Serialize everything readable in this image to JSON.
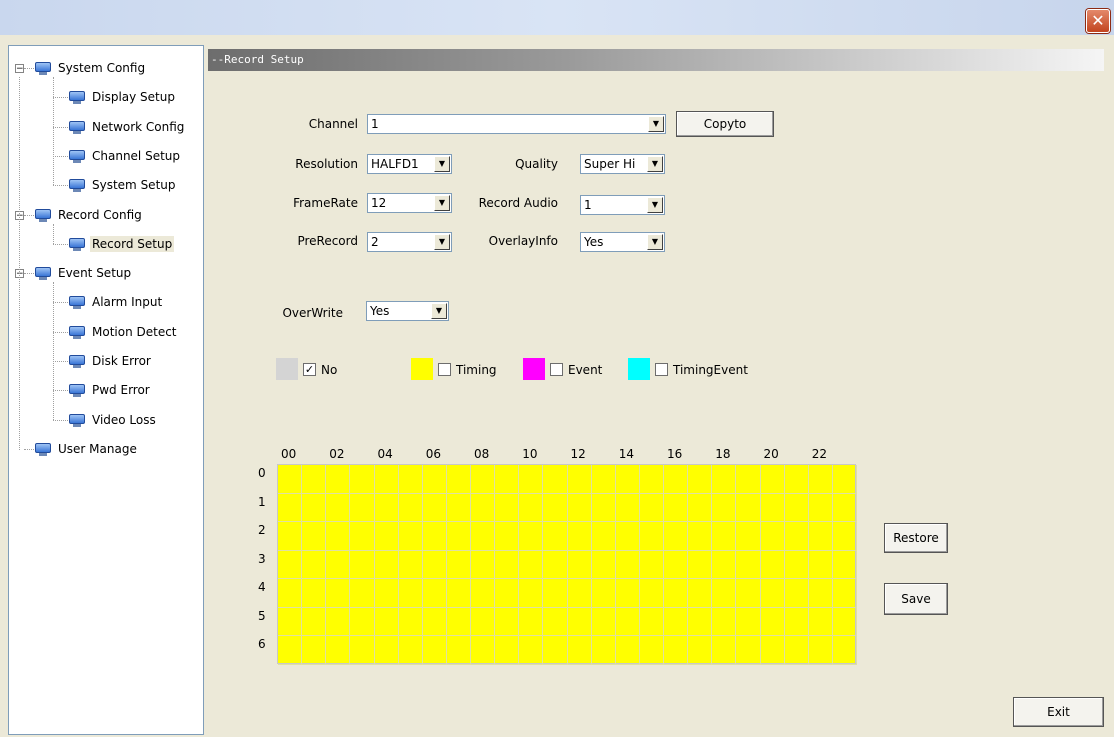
{
  "window": {
    "close_glyph": "✕"
  },
  "tree": {
    "nodes": [
      {
        "label": "System Config",
        "level": 0,
        "expander": "−"
      },
      {
        "label": "Display Setup",
        "level": 1
      },
      {
        "label": "Network Config",
        "level": 1
      },
      {
        "label": "Channel Setup",
        "level": 1
      },
      {
        "label": "System Setup",
        "level": 1
      },
      {
        "label": "Record Config",
        "level": 0,
        "expander": "−"
      },
      {
        "label": "Record Setup",
        "level": 1,
        "selected": true
      },
      {
        "label": "Event Setup",
        "level": 0,
        "expander": "−"
      },
      {
        "label": "Alarm Input",
        "level": 1
      },
      {
        "label": "Motion Detect",
        "level": 1
      },
      {
        "label": "Disk Error",
        "level": 1
      },
      {
        "label": "Pwd Error",
        "level": 1
      },
      {
        "label": "Video Loss",
        "level": 1
      },
      {
        "label": "User Manage",
        "level": 0
      }
    ]
  },
  "panel": {
    "title": "--Record Setup",
    "channel": {
      "label": "Channel",
      "value": "1"
    },
    "copyto_label": "Copyto",
    "resolution": {
      "label": "Resolution",
      "value": "HALFD1"
    },
    "quality": {
      "label": "Quality",
      "value": "Super Hi"
    },
    "framerate": {
      "label": "FrameRate",
      "value": "12"
    },
    "record_audio": {
      "label": "Record Audio",
      "value": "1"
    },
    "prerecord": {
      "label": "PreRecord",
      "value": "2"
    },
    "overlayinfo": {
      "label": "OverlayInfo",
      "value": "Yes"
    },
    "overwrite": {
      "label": "OverWrite",
      "value": "Yes"
    },
    "legend": [
      {
        "name": "No",
        "color": "#d4d4d4",
        "checked": true
      },
      {
        "name": "Timing",
        "color": "#ffff00",
        "checked": false
      },
      {
        "name": "Event",
        "color": "#ff00ff",
        "checked": false
      },
      {
        "name": "TimingEvent",
        "color": "#00ffff",
        "checked": false
      }
    ],
    "check_glyph": "✓",
    "hours": [
      "00",
      "02",
      "04",
      "06",
      "08",
      "10",
      "12",
      "14",
      "16",
      "18",
      "20",
      "22"
    ],
    "days": [
      "0",
      "1",
      "2",
      "3",
      "4",
      "5",
      "6"
    ],
    "schedule_fill": "#ffff00",
    "restore_label": "Restore",
    "save_label": "Save",
    "exit_label": "Exit"
  }
}
